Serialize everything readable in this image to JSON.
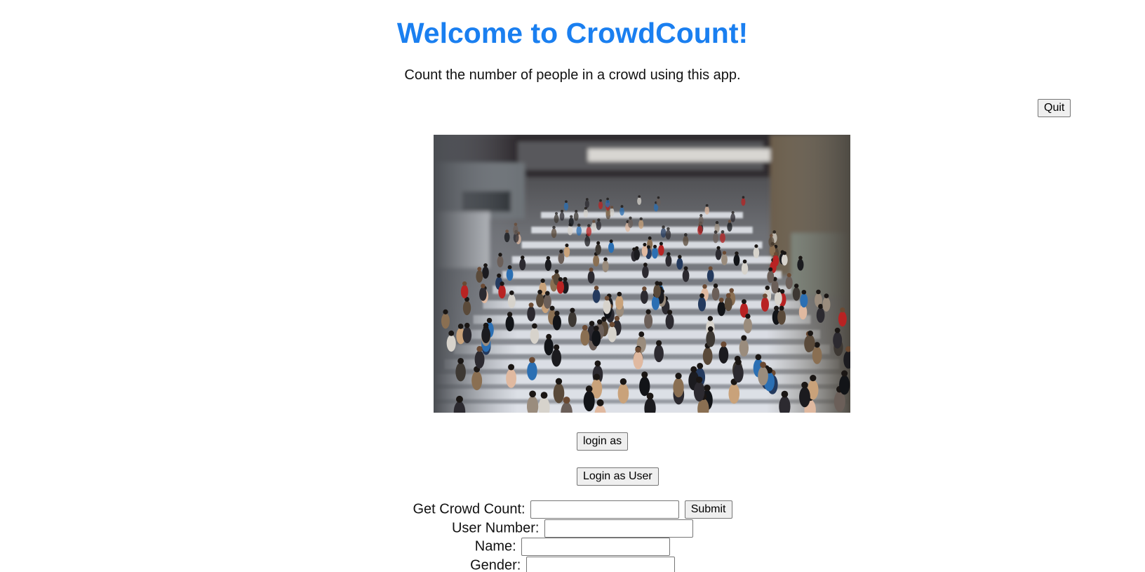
{
  "header": {
    "title": "Welcome to CrowdCount!",
    "subtitle": "Count the number of people in a crowd using this app."
  },
  "actions": {
    "quit_label": "Quit",
    "login_as_label": "login as",
    "login_as_user_label": "Login as User"
  },
  "image": {
    "description_icon": "crowd-photo"
  },
  "form": {
    "crowd_count_label": "Get Crowd Count:",
    "crowd_count_value": "",
    "submit_label": "Submit",
    "user_number_label": "User Number:",
    "user_number_value": "",
    "name_label": "Name:",
    "name_value": "",
    "gender_label": "Gender:",
    "gender_value": ""
  },
  "colors": {
    "title": "#1a7ff0",
    "text": "#111111",
    "background": "#ffffff"
  }
}
